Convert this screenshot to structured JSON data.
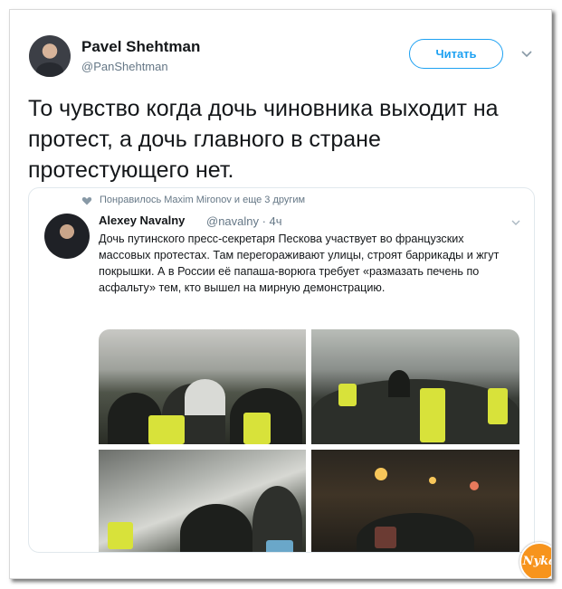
{
  "tweet": {
    "author_name": "Pavel Shehtman",
    "author_handle": "@PanShehtman",
    "follow_label": "Читать",
    "text": "То чувство когда дочь чиновника выходит на протест, а дочь главного в стране протестующего нет."
  },
  "quoted": {
    "liked_by": "Понравилось Maxim Mironov и еще 3 другим",
    "author_name": "Alexey Navalny",
    "author_handle": "@navalny · 4ч",
    "text": "Дочь путинского пресс-секретаря Пескова участвует во французских массовых протестах. Там перегораживают улицы, строят баррикады и жгут покрышки. А в России её папаша-ворюга требует «размазать печень по асфальту» тем, кто вышел на мирную демонстрацию.",
    "photos": [
      "photo-crowd-yellow-vests",
      "photo-street-protest",
      "photo-tear-gas",
      "photo-night-street"
    ]
  },
  "watermark": "Nyka",
  "colors": {
    "accent": "#1da1f2",
    "text": "#14171a",
    "muted": "#657786",
    "logo": "#f7941d"
  }
}
